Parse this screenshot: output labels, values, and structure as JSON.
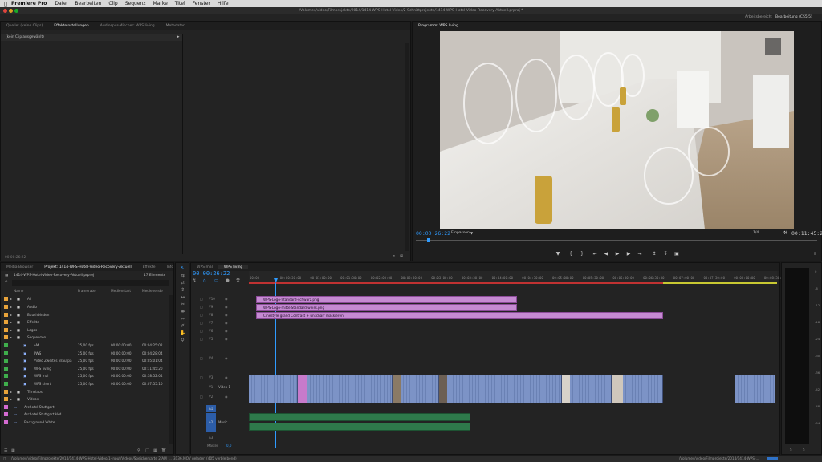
{
  "menubar": {
    "app_name": "Premiere Pro",
    "items": [
      "Datei",
      "Bearbeiten",
      "Clip",
      "Sequenz",
      "Marke",
      "Titel",
      "Fenster",
      "Hilfe"
    ]
  },
  "titlebar": {
    "path": "/Volumes/video/Filmprojekte/2014/1414-WPS-Hotel-Video/2-Schnittprojekte/1414-WPS-Hotel-Video-Recovery-Aktuell.prproj *"
  },
  "workspace": {
    "label": "Arbeitsbereich:",
    "value": "Bearbeitung (CS5.5)"
  },
  "source_panel": {
    "tabs": [
      "Quelle: (keine Clips)",
      "Effekteinstellungen",
      "Audiospur-Mischer: WPS living",
      "Metadaten"
    ],
    "active_tab": 1,
    "no_clip": "(kein Clip ausgewählt)",
    "timecode": "00:00:26:22"
  },
  "program": {
    "title": "Programm: WPS living",
    "timecode": "00:00:26:22",
    "fit": "Einpassen",
    "quality": "1/4",
    "duration": "00:11:45:21"
  },
  "project": {
    "tabs": [
      "Media-Browser",
      "Projekt: 1414-WPS-Hotel-Video-Recovery-Aktuell",
      "Effekte",
      "Info"
    ],
    "file": "1414-WPS-Hotel-Video-Recovery-Aktuell.prproj",
    "count": "17 Elemente",
    "columns": [
      "Name",
      "Framerate",
      "Medienstart",
      "Medienende"
    ],
    "rows": [
      {
        "name": "All",
        "fps": "",
        "start": "",
        "end": "",
        "color": "#e8a33a",
        "indent": 1
      },
      {
        "name": "Audio",
        "fps": "",
        "start": "",
        "end": "",
        "color": "#e8a33a",
        "indent": 1
      },
      {
        "name": "Bauchbinden",
        "fps": "",
        "start": "",
        "end": "",
        "color": "#e8a33a",
        "indent": 1
      },
      {
        "name": "Effekte",
        "fps": "",
        "start": "",
        "end": "",
        "color": "#e8a33a",
        "indent": 1
      },
      {
        "name": "Logos",
        "fps": "",
        "start": "",
        "end": "",
        "color": "#e8a33a",
        "indent": 1
      },
      {
        "name": "Sequenzen",
        "fps": "",
        "start": "",
        "end": "",
        "color": "#e8a33a",
        "indent": 1
      },
      {
        "name": "AM",
        "fps": "25,00 fps",
        "start": "00:00:00:00",
        "end": "00:04:25:02",
        "color": "#3fae4c",
        "indent": 3
      },
      {
        "name": "PWS",
        "fps": "25,00 fps",
        "start": "00:00:00:00",
        "end": "00:04:28:04",
        "color": "#3fae4c",
        "indent": 3
      },
      {
        "name": "Video Zweites Brautpa",
        "fps": "25,00 fps",
        "start": "00:00:00:00",
        "end": "00:05:01:04",
        "color": "#3fae4c",
        "indent": 3
      },
      {
        "name": "WPS living",
        "fps": "25,00 fps",
        "start": "00:00:00:00",
        "end": "00:11:45:20",
        "color": "#3fae4c",
        "indent": 3
      },
      {
        "name": "WPS mal",
        "fps": "25,00 fps",
        "start": "00:00:00:00",
        "end": "00:38:52:04",
        "color": "#3fae4c",
        "indent": 3
      },
      {
        "name": "WPS short",
        "fps": "25,00 fps",
        "start": "00:00:00:00",
        "end": "00:07:55:10",
        "color": "#3fae4c",
        "indent": 3
      },
      {
        "name": "Timelaps",
        "fps": "",
        "start": "",
        "end": "",
        "color": "#e8a33a",
        "indent": 1
      },
      {
        "name": "Videos",
        "fps": "",
        "start": "",
        "end": "",
        "color": "#e8a33a",
        "indent": 1
      },
      {
        "name": "Archotel Stuttgart",
        "fps": "",
        "start": "",
        "end": "",
        "color": "#d46bd1",
        "indent": 0
      },
      {
        "name": "Archotel Stuttgart kkd",
        "fps": "",
        "start": "",
        "end": "",
        "color": "#d46bd1",
        "indent": 0
      },
      {
        "name": "Background White",
        "fps": "",
        "start": "",
        "end": "",
        "color": "#d46bd1",
        "indent": 0
      }
    ]
  },
  "timeline": {
    "tabs": [
      "WPS mal",
      "WPS living"
    ],
    "active_tab": 1,
    "timecode": "00:00:26:22",
    "ruler": [
      "00:00",
      "00:00:30:00",
      "00:01:00:00",
      "00:01:30:00",
      "00:02:00:00",
      "00:02:30:00",
      "00:03:00:00",
      "00:03:30:00",
      "00:04:00:00",
      "00:04:30:00",
      "00:05:00:00",
      "00:05:30:00",
      "00:06:00:00",
      "00:06:30:00",
      "00:07:00:00",
      "00:07:30:00",
      "00:08:00:00",
      "00:08:30:0"
    ],
    "video_tracks": [
      "V10",
      "V9",
      "V8",
      "V7",
      "V6",
      "V5",
      "V4",
      "V3",
      "V2",
      "V1"
    ],
    "v1_name": "Video 1",
    "audio_tracks": [
      "A1",
      "A2",
      "A3"
    ],
    "a2_name": "Music",
    "master_label": "Master",
    "master_value": "0,0",
    "clips": [
      {
        "label": "WPS-Logo-Standard-schwarz.png"
      },
      {
        "label": "WPS-Logo-mittelStandard-weiss.png"
      },
      {
        "label": "Cinestyle grand Contrast + unscharf maskieren"
      }
    ]
  },
  "meter": {
    "labels": [
      "0",
      "-6",
      "-12",
      "-18",
      "-24",
      "-30",
      "-36",
      "-42",
      "-48",
      "-54"
    ],
    "bottom": [
      "S",
      "S"
    ]
  },
  "status": {
    "left": "/Volumes/video/Filmprojekte/2014/1414-WPS-Hotel-Video/1-Input/Videos/Speicherkarte 2/AM_..._3136.MOV geladen (405 verbleibend)",
    "right": "/Volumes/video/Filmprojekte/2014/1414-WPS-..."
  }
}
